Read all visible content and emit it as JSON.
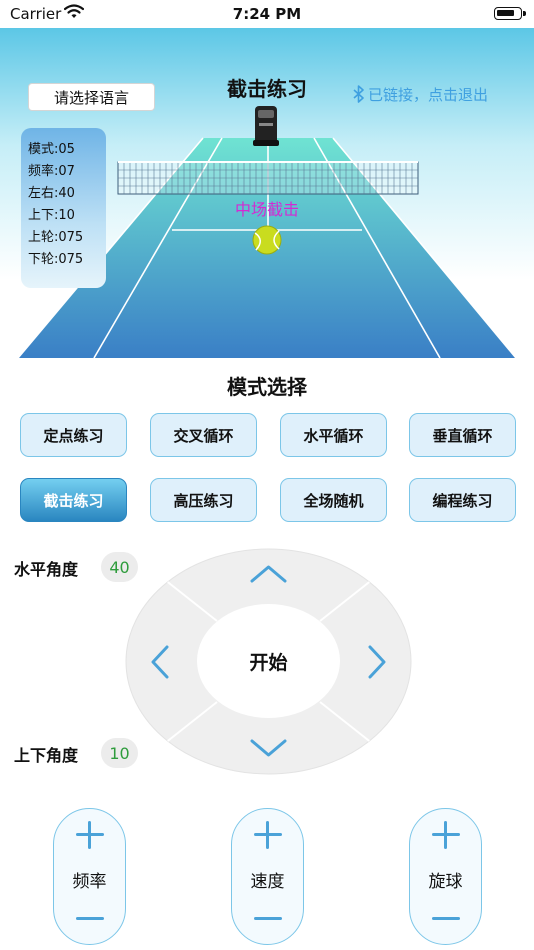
{
  "status_bar": {
    "carrier": "Carrier",
    "time": "7:24 PM"
  },
  "hero": {
    "language_button": "请选择语言",
    "title": "截击练习",
    "bluetooth_status": "已链接，点击退出",
    "zone_label": "中场截击",
    "info": [
      {
        "label": "模式:",
        "value": "05"
      },
      {
        "label": "频率:",
        "value": "07"
      },
      {
        "label": "左右:",
        "value": "40"
      },
      {
        "label": "上下:",
        "value": "10"
      },
      {
        "label": "上轮:",
        "value": "075"
      },
      {
        "label": "下轮:",
        "value": "075"
      }
    ]
  },
  "mode_section": {
    "title": "模式选择",
    "modes": [
      {
        "label": "定点练习",
        "active": false
      },
      {
        "label": "交叉循环",
        "active": false
      },
      {
        "label": "水平循环",
        "active": false
      },
      {
        "label": "垂直循环",
        "active": false
      },
      {
        "label": "截击练习",
        "active": true
      },
      {
        "label": "高压练习",
        "active": false
      },
      {
        "label": "全场随机",
        "active": false
      },
      {
        "label": "编程练习",
        "active": false
      }
    ]
  },
  "angles": {
    "horizontal_label": "水平角度",
    "horizontal_value": "40",
    "vertical_label": "上下角度",
    "vertical_value": "10"
  },
  "controller": {
    "start_label": "开始"
  },
  "steppers": [
    {
      "label": "频率"
    },
    {
      "label": "速度"
    },
    {
      "label": "旋球"
    }
  ],
  "colors": {
    "accent": "#4aa2d8",
    "court_top": "#6fe3d2",
    "court_bottom": "#3a7fc6",
    "zone_label": "#d32ad3",
    "angle_value": "#2e9c3c",
    "bluetooth": "#3fa0e0"
  },
  "icons": [
    "wifi-icon",
    "battery-icon",
    "bluetooth-icon",
    "ball-machine-icon",
    "tennis-ball-icon",
    "arrow-up-icon",
    "arrow-down-icon",
    "arrow-left-icon",
    "arrow-right-icon",
    "plus-icon",
    "minus-icon"
  ]
}
